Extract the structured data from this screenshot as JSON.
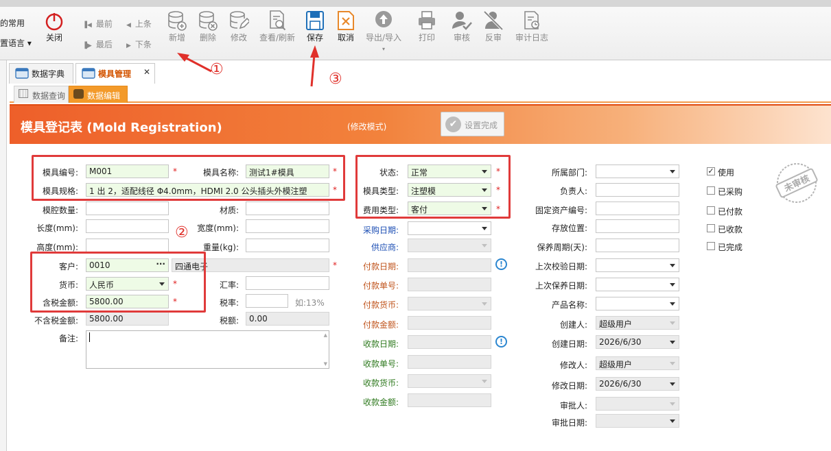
{
  "ribbon": {
    "group_left_1": "的常用",
    "group_left_2": "置语言",
    "close_label": "关闭",
    "nav": {
      "first": "最前",
      "prev": "上条",
      "last": "最后",
      "next": "下条"
    },
    "buttons": {
      "add": "新增",
      "delete": "删除",
      "edit": "修改",
      "query": "查看/刷新",
      "save": "保存",
      "cancel": "取消",
      "import_export": "导出/导入",
      "print": "打印",
      "audit": "审核",
      "unaudit": "反审",
      "audit_log": "审计日志"
    }
  },
  "tabs": [
    {
      "label": "数据字典"
    },
    {
      "label": "模具管理"
    }
  ],
  "subtabs": [
    {
      "label": "数据查询"
    },
    {
      "label": "数据编辑"
    }
  ],
  "header": {
    "title": "模具登记表 (Mold Registration)",
    "mode": "(修改模式)",
    "done_button": "设置完成"
  },
  "form": {
    "mold_no": {
      "label": "模具编号:",
      "value": "M001"
    },
    "mold_name": {
      "label": "模具名称:",
      "value": "测试1#模具"
    },
    "spec": {
      "label": "模具规格:",
      "value": "1 出 2，适配线径 Φ4.0mm，HDMI 2.0 公头插头外模注塑"
    },
    "cavity": {
      "label": "模腔数量:",
      "value": ""
    },
    "material": {
      "label": "材质:",
      "value": ""
    },
    "length": {
      "label": "长度(mm):",
      "value": ""
    },
    "width": {
      "label": "宽度(mm):",
      "value": ""
    },
    "height": {
      "label": "高度(mm):",
      "value": ""
    },
    "weight": {
      "label": "重量(kg):",
      "value": ""
    },
    "customer": {
      "label": "客户:",
      "code": "0010",
      "name": "四通电子"
    },
    "currency": {
      "label": "货币:",
      "value": "人民币"
    },
    "exchange": {
      "label": "汇率:",
      "value": ""
    },
    "amount_tax": {
      "label": "含税金额:",
      "value": "5800.00"
    },
    "tax_rate": {
      "label": "税率:",
      "value": "",
      "hint": "如:13%"
    },
    "amount_notax": {
      "label": "不含税金额:",
      "value": "5800.00"
    },
    "tax_amount": {
      "label": "税额:",
      "value": "0.00"
    },
    "remark": {
      "label": "备注:",
      "value": ""
    },
    "status": {
      "label": "状态:",
      "value": "正常"
    },
    "mold_type": {
      "label": "模具类型:",
      "value": "注塑模"
    },
    "fee_type": {
      "label": "费用类型:",
      "value": "客付"
    },
    "purchase_date": {
      "label": "采购日期:",
      "value": ""
    },
    "supplier": {
      "label": "供应商:",
      "value": ""
    },
    "pay_date": {
      "label": "付款日期:",
      "value": ""
    },
    "pay_no": {
      "label": "付款单号:",
      "value": ""
    },
    "pay_currency": {
      "label": "付款货币:",
      "value": ""
    },
    "pay_amount": {
      "label": "付款金额:",
      "value": ""
    },
    "recv_date": {
      "label": "收款日期:",
      "value": ""
    },
    "recv_no": {
      "label": "收款单号:",
      "value": ""
    },
    "recv_currency": {
      "label": "收款货币:",
      "value": ""
    },
    "recv_amount": {
      "label": "收款金额:",
      "value": ""
    },
    "dept": {
      "label": "所属部门:",
      "value": ""
    },
    "owner": {
      "label": "负责人:",
      "value": ""
    },
    "asset_no": {
      "label": "固定资产编号:",
      "value": ""
    },
    "location": {
      "label": "存放位置:",
      "value": ""
    },
    "maint_cycle": {
      "label": "保养周期(天):",
      "value": ""
    },
    "last_calib": {
      "label": "上次校验日期:",
      "value": ""
    },
    "last_maint": {
      "label": "上次保养日期:",
      "value": ""
    },
    "product": {
      "label": "产品名称:",
      "value": ""
    },
    "creator": {
      "label": "创建人:",
      "value": "超级用户"
    },
    "create_date": {
      "label": "创建日期:",
      "value": "2026/6/30"
    },
    "modifier": {
      "label": "修改人:",
      "value": "超级用户"
    },
    "modify_date": {
      "label": "修改日期:",
      "value": "2026/6/30"
    },
    "approver": {
      "label": "审批人:",
      "value": ""
    },
    "approve_date": {
      "label": "审批日期:",
      "value": ""
    }
  },
  "checks": [
    {
      "label": "使用",
      "checked": true
    },
    {
      "label": "已采购",
      "checked": false
    },
    {
      "label": "已付款",
      "checked": false
    },
    {
      "label": "已收款",
      "checked": false
    },
    {
      "label": "已完成",
      "checked": false
    }
  ],
  "stamp": {
    "text": "未审核"
  },
  "annotations": {
    "one": "①",
    "two": "②",
    "three": "③"
  },
  "colors": {
    "accent": "#f2823c",
    "annotation": "#e03a3a",
    "required_bg": "#eefbe6"
  }
}
